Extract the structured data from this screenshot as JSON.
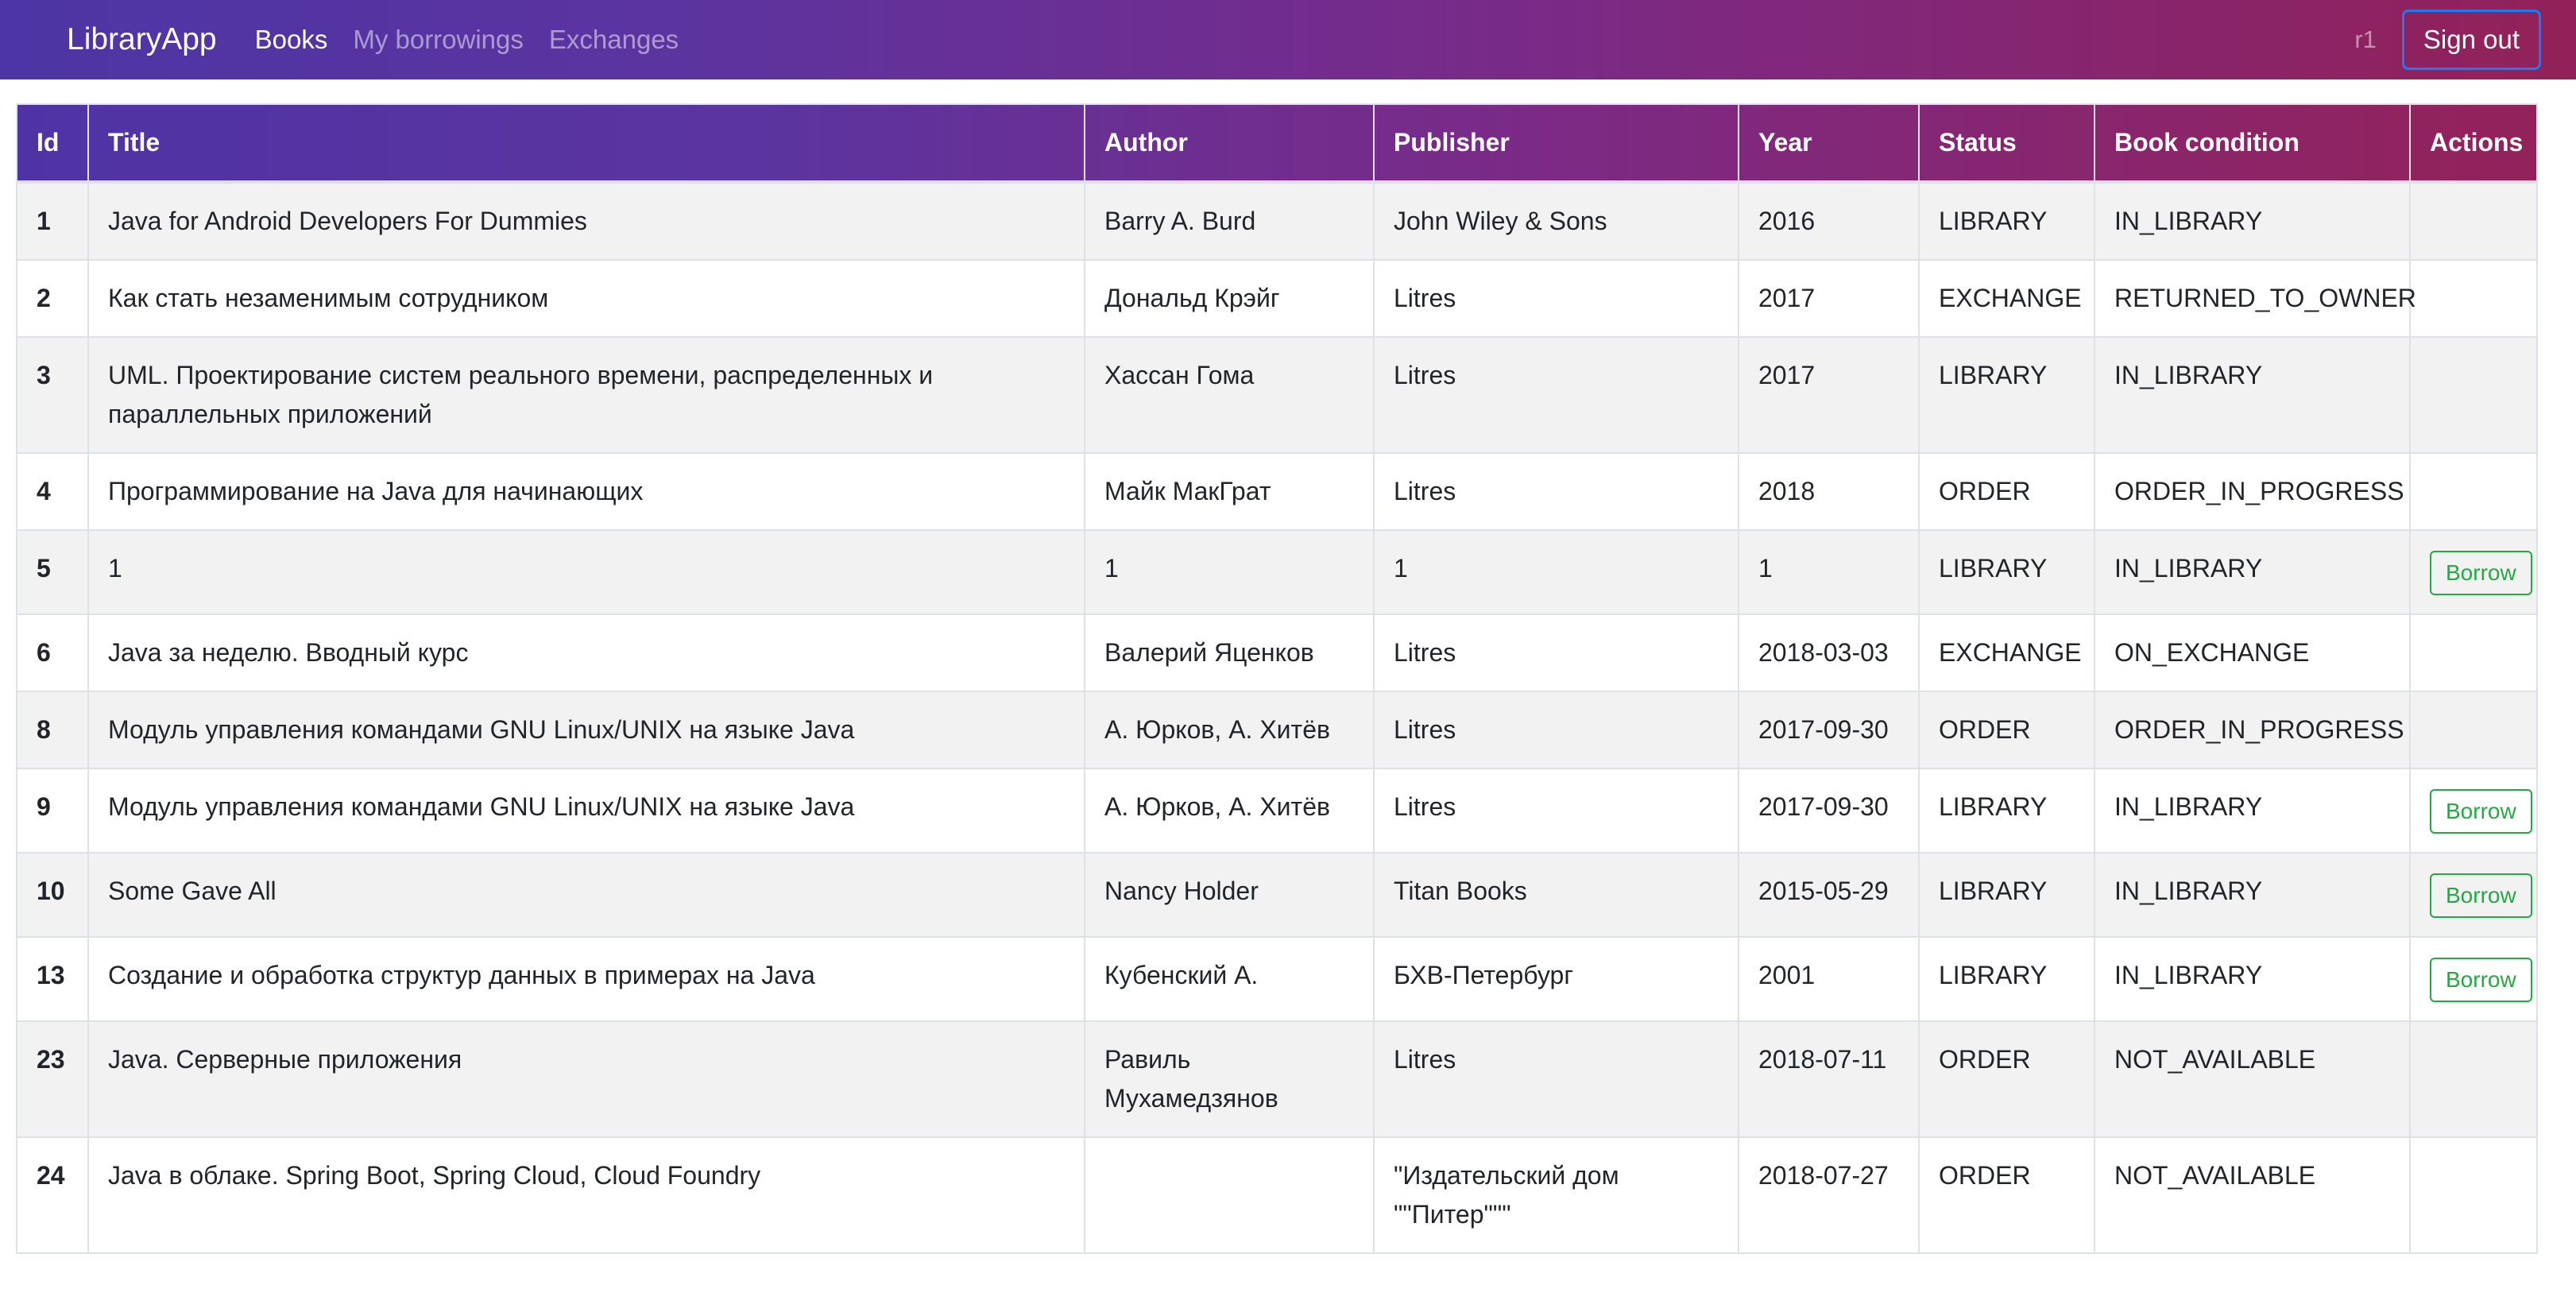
{
  "nav": {
    "brand": "LibraryApp",
    "links": [
      "Books",
      "My borrowings",
      "Exchanges"
    ],
    "user": "r1",
    "signout": "Sign out"
  },
  "table": {
    "headers": [
      "Id",
      "Title",
      "Author",
      "Publisher",
      "Year",
      "Status",
      "Book condition",
      "Actions"
    ],
    "rows": [
      {
        "id": "1",
        "title": "Java for Android Developers For Dummies",
        "author": "Barry A. Burd",
        "publisher": "John Wiley & Sons",
        "year": "2016",
        "status": "LIBRARY",
        "condition": "IN_LIBRARY",
        "action": ""
      },
      {
        "id": "2",
        "title": "Как стать незаменимым сотрудником",
        "author": "Дональд Крэйг",
        "publisher": "Litres",
        "year": "2017",
        "status": "EXCHANGE",
        "condition": "RETURNED_TO_OWNER",
        "action": ""
      },
      {
        "id": "3",
        "title": "UML. Проектирование систем реального времени, распределенных и параллельных приложений",
        "author": "Хассан Гома",
        "publisher": "Litres",
        "year": "2017",
        "status": "LIBRARY",
        "condition": "IN_LIBRARY",
        "action": ""
      },
      {
        "id": "4",
        "title": "Программирование на Java для начинающих",
        "author": "Майк МакГрат",
        "publisher": "Litres",
        "year": "2018",
        "status": "ORDER",
        "condition": "ORDER_IN_PROGRESS",
        "action": ""
      },
      {
        "id": "5",
        "title": "1",
        "author": "1",
        "publisher": "1",
        "year": "1",
        "status": "LIBRARY",
        "condition": "IN_LIBRARY",
        "action": "Borrow"
      },
      {
        "id": "6",
        "title": "Java за неделю. Вводный курс",
        "author": "Валерий Яценков",
        "publisher": "Litres",
        "year": "2018-03-03",
        "status": "EXCHANGE",
        "condition": "ON_EXCHANGE",
        "action": ""
      },
      {
        "id": "8",
        "title": "Модуль управления командами GNU Linux/UNIX на языке Java",
        "author": "А. Юрков, А. Хитёв",
        "publisher": "Litres",
        "year": "2017-09-30",
        "status": "ORDER",
        "condition": "ORDER_IN_PROGRESS",
        "action": ""
      },
      {
        "id": "9",
        "title": "Модуль управления командами GNU Linux/UNIX на языке Java",
        "author": "А. Юрков, А. Хитёв",
        "publisher": "Litres",
        "year": "2017-09-30",
        "status": "LIBRARY",
        "condition": "IN_LIBRARY",
        "action": "Borrow"
      },
      {
        "id": "10",
        "title": "Some Gave All",
        "author": "Nancy Holder",
        "publisher": "Titan Books",
        "year": "2015-05-29",
        "status": "LIBRARY",
        "condition": "IN_LIBRARY",
        "action": "Borrow"
      },
      {
        "id": "13",
        "title": "Создание и обработка структур данных в примерах на Java",
        "author": "Кубенский А.",
        "publisher": "БХВ-Петербург",
        "year": "2001",
        "status": "LIBRARY",
        "condition": "IN_LIBRARY",
        "action": "Borrow"
      },
      {
        "id": "23",
        "title": "Java. Серверные приложения",
        "author": "Равиль Мухамедзянов",
        "publisher": "Litres",
        "year": "2018-07-11",
        "status": "ORDER",
        "condition": "NOT_AVAILABLE",
        "action": ""
      },
      {
        "id": "24",
        "title": "Java в облаке. Spring Boot, Spring Cloud, Cloud Foundry",
        "author": "",
        "publisher": "\"Издательский дом \"\"Питер\"\"\"",
        "year": "2018-07-27",
        "status": "ORDER",
        "condition": "NOT_AVAILABLE",
        "action": ""
      }
    ]
  },
  "colors": {
    "borrow": "#28a745",
    "signout_border": "#1a7cf5"
  }
}
